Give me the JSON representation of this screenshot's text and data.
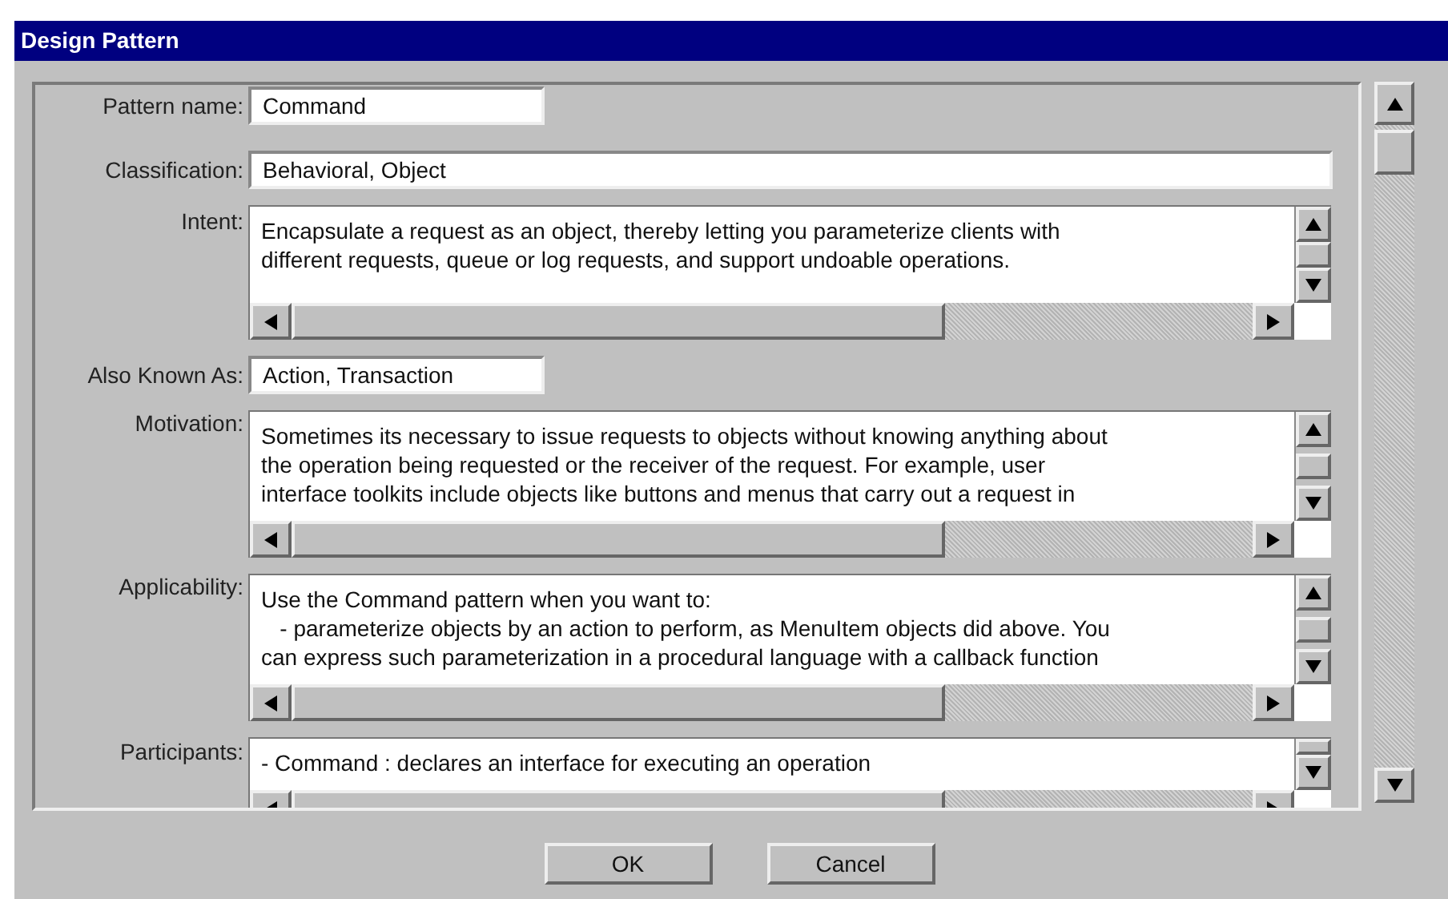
{
  "window": {
    "title": "Design Pattern"
  },
  "fields": [
    {
      "kind": "short_line",
      "label": "Pattern name:",
      "value": "Command"
    },
    {
      "kind": "long_line",
      "label": "Classification:",
      "value": "Behavioral, Object"
    },
    {
      "kind": "area",
      "label": "Intent:",
      "text": "Encapsulate a request as an object, thereby letting you parameterize clients with\ndifferent requests, queue or log requests, and support undoable operations."
    },
    {
      "kind": "short_line",
      "label": "Also Known As:",
      "value": "Action, Transaction"
    },
    {
      "kind": "area",
      "label": "Motivation:",
      "text": "Sometimes its necessary to issue requests to objects without knowing anything about\nthe operation being requested or the receiver of the request. For example, user\ninterface toolkits include objects like buttons and menus that carry out a request in"
    },
    {
      "kind": "area",
      "label": "Applicability:",
      "text": "Use the Command pattern when you want to:\n   - parameterize objects by an action to perform, as MenuItem objects did above. You\ncan express such parameterization in a procedural language with a callback function"
    },
    {
      "kind": "area_cut",
      "label": "Participants:",
      "text": "- Command : declares an interface for executing an operation"
    }
  ],
  "buttons": [
    "OK",
    "Cancel"
  ]
}
